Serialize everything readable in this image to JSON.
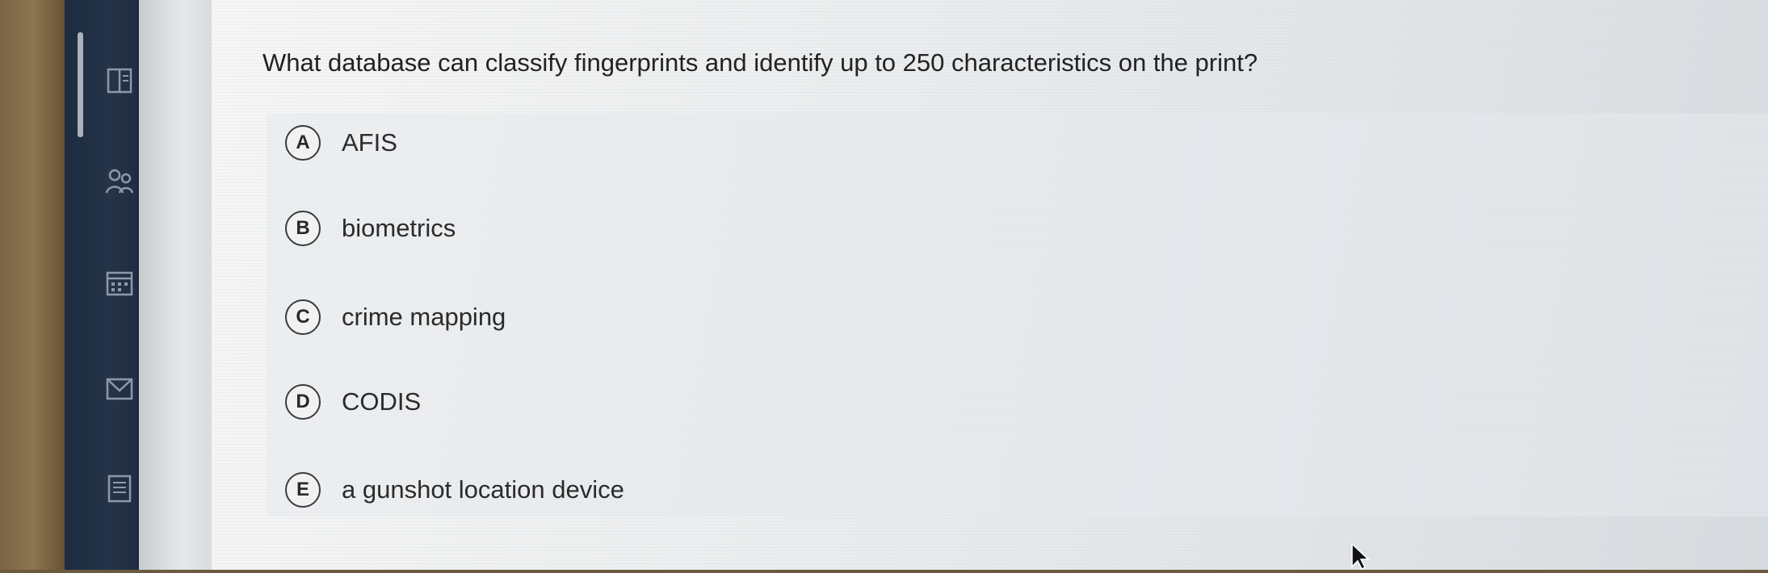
{
  "question": {
    "text": "What database can classify fingerprints and identify up to 250 characteristics on the print?"
  },
  "options": [
    {
      "letter": "A",
      "text": "AFIS"
    },
    {
      "letter": "B",
      "text": "biometrics"
    },
    {
      "letter": "C",
      "text": "crime mapping"
    },
    {
      "letter": "D",
      "text": "CODIS"
    },
    {
      "letter": "E",
      "text": "a gunshot location device"
    }
  ],
  "sidebar": {
    "icons": [
      "book-icon",
      "people-icon",
      "calendar-icon",
      "mail-icon",
      "document-icon"
    ]
  },
  "colors": {
    "sidebar": "#253449",
    "page": "#eceeef",
    "text": "#222222"
  }
}
